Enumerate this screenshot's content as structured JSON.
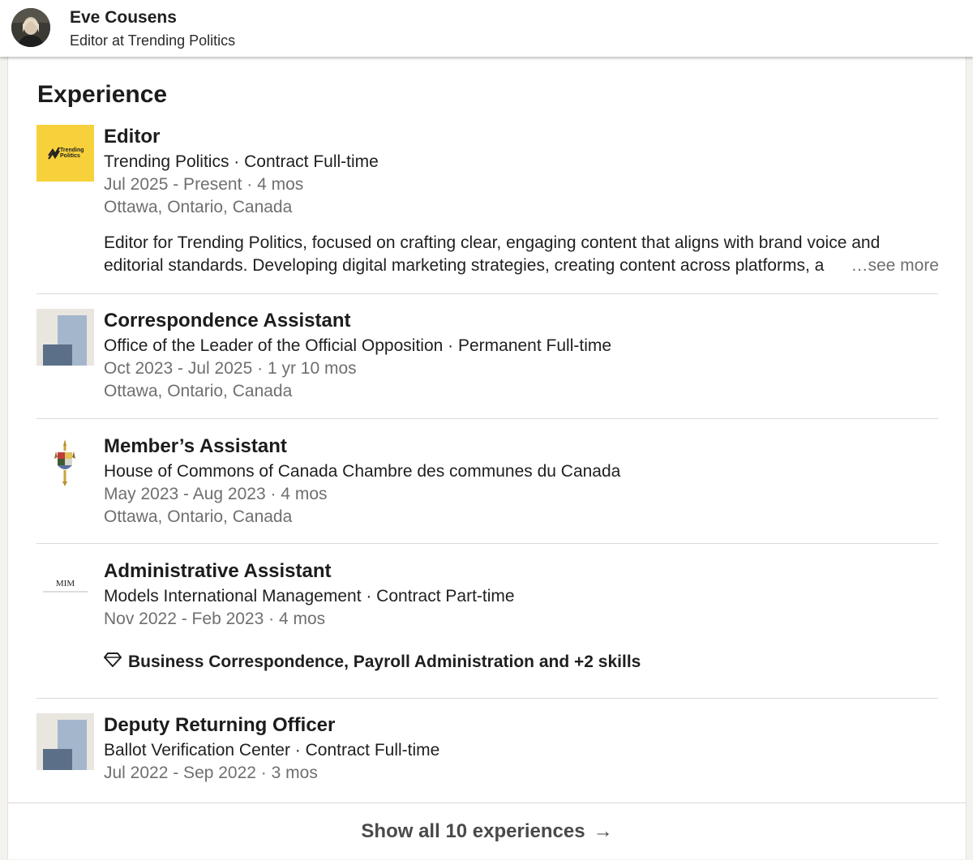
{
  "header": {
    "name": "Eve Cousens",
    "subtitle": "Editor at Trending Politics"
  },
  "section": {
    "title": "Experience"
  },
  "experiences": [
    {
      "title": "Editor",
      "company_line": "Trending Politics · Contract Full-time",
      "dates": "Jul 2025 - Present · 4 mos",
      "location": "Ottawa, Ontario, Canada",
      "description_line1": "Editor for Trending Politics, focused on crafting clear, engaging content that aligns with brand voice and",
      "description_line2": "editorial standards. Developing digital marketing strategies, creating content across platforms, a",
      "see_more": "…see more",
      "logo": "trending-politics-logo",
      "logo_text_1": "Trending",
      "logo_text_2": "Politics"
    },
    {
      "title": "Correspondence Assistant",
      "company_line": "Office of the Leader of the Official Opposition · Permanent Full-time",
      "dates": "Oct 2023 - Jul 2025 · 1 yr 10 mos",
      "location": "Ottawa, Ontario, Canada",
      "logo": "placeholder-company-logo"
    },
    {
      "title": "Member’s Assistant",
      "company_line": "House of Commons of Canada Chambre des communes du Canada",
      "dates": "May 2023 - Aug 2023 · 4 mos",
      "location": "Ottawa, Ontario, Canada",
      "logo": "house-of-commons-crest-logo"
    },
    {
      "title": "Administrative Assistant",
      "company_line": "Models International Management · Contract Part-time",
      "dates": "Nov 2022 - Feb 2023 · 4 mos",
      "skills": "Business Correspondence, Payroll Administration and +2 skills",
      "logo": "mim-logo",
      "logo_text": "MIM"
    },
    {
      "title": "Deputy Returning Officer",
      "company_line": "Ballot Verification Center · Contract Full-time",
      "dates": "Jul 2022 - Sep 2022 · 3 mos",
      "logo": "placeholder-company-logo"
    }
  ],
  "footer": {
    "show_all": "Show all 10 experiences",
    "arrow": "→"
  },
  "colors": {
    "trending_yellow": "#f7d13b",
    "placeholder_light": "#a4b6cc",
    "placeholder_dark": "#5b6f89",
    "muted_text": "#6f6f6f"
  }
}
